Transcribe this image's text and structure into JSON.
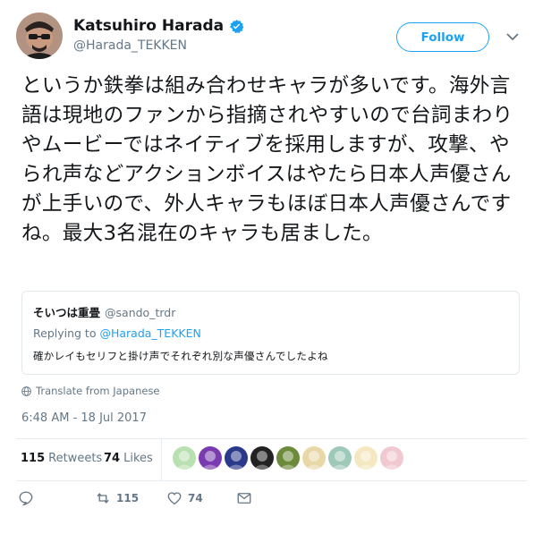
{
  "colors": {
    "accent": "#1da1f2",
    "text": "#14171a",
    "muted": "#657786",
    "border": "#e1e8ed"
  },
  "author": {
    "name": "Katsuhiro Harada",
    "handle": "@Harada_TEKKEN",
    "avatar_icon": "avatar",
    "verified_icon": "verified-badge-icon"
  },
  "follow_label": "Follow",
  "tweet_text": "というか鉄拳は組み合わせキャラが多いです。海外言語は現地のファンから指摘されやすいので台詞まわりやムービーではネイティブを採用しますが、攻撃、やられ声などアクションボイスはやたら日本人声優さんが上手いので、外人キャラもほぼ日本人声優さんですね。最大3名混在のキャラも居ました。",
  "quote": {
    "name": "そいつは重畳",
    "handle": "@sando_trdr",
    "replying_prefix": "Replying to",
    "replying_to": "@Harada_TEKKEN",
    "text": "確かレイもセリフと掛け声でそれぞれ別な声優さんでしたよね"
  },
  "translate_label": "Translate from Japanese",
  "timestamp": "6:48 AM - 18 Jul 2017",
  "stats": {
    "retweets_count": "115",
    "retweets_label": "Retweets",
    "likes_count": "74",
    "likes_label": "Likes"
  },
  "likers": [
    {
      "icon": "liker-avatar-1",
      "color": "#b8e0b0"
    },
    {
      "icon": "liker-avatar-2",
      "color": "#7a3bb0"
    },
    {
      "icon": "liker-avatar-3",
      "color": "#2a3a8a"
    },
    {
      "icon": "liker-avatar-4",
      "color": "#222222"
    },
    {
      "icon": "liker-avatar-5",
      "color": "#6b8a3a"
    },
    {
      "icon": "liker-avatar-6",
      "color": "#e8d8a8"
    },
    {
      "icon": "liker-avatar-7",
      "color": "#9ec8b8"
    },
    {
      "icon": "liker-avatar-8",
      "color": "#f4e8c0"
    },
    {
      "icon": "liker-avatar-9",
      "color": "#f0c8d0"
    }
  ],
  "actions": {
    "reply_icon": "reply-icon",
    "retweet_icon": "retweet-icon",
    "retweet_count": "115",
    "like_icon": "heart-icon",
    "like_count": "74",
    "dm_icon": "envelope-icon"
  }
}
